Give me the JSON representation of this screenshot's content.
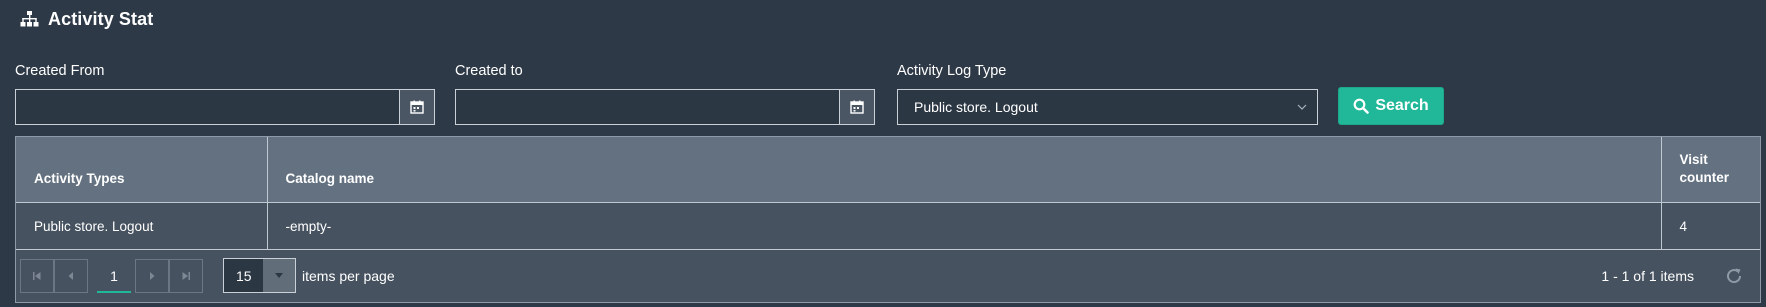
{
  "header": {
    "title": "Activity Stat",
    "icon": "sitemap-icon"
  },
  "filters": {
    "created_from": {
      "label": "Created From",
      "value": "",
      "icon": "calendar-icon"
    },
    "created_to": {
      "label": "Created to",
      "value": "",
      "icon": "calendar-icon"
    },
    "activity_log_type": {
      "label": "Activity Log Type",
      "selected": "Public store. Logout",
      "icon": "chevron-down-icon"
    },
    "search_button": {
      "label": "Search",
      "icon": "search-icon"
    }
  },
  "table": {
    "columns": [
      "Activity Types",
      "Catalog name",
      "Visit\ncounter"
    ],
    "rows": [
      [
        "Public store. Logout",
        "-empty-",
        "4"
      ]
    ]
  },
  "pager": {
    "current_page": "1",
    "page_size": "15",
    "per_page_label": "items per page",
    "range_text": "1 - 1 of 1 items"
  },
  "colors": {
    "background": "#2e3947",
    "header_row": "#637180",
    "body_row": "#46525f",
    "accent": "#20b898"
  }
}
